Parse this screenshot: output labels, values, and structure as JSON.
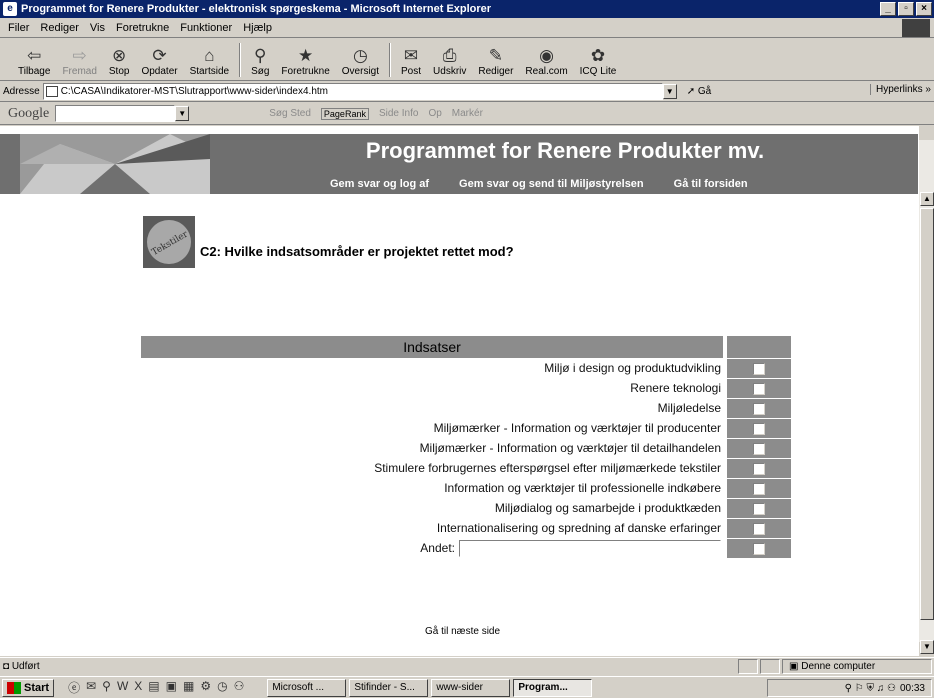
{
  "window": {
    "title": "Programmet for Renere Produkter - elektronisk spørgeskema - Microsoft Internet Explorer"
  },
  "menu": [
    "Filer",
    "Rediger",
    "Vis",
    "Foretrukne",
    "Funktioner",
    "Hjælp"
  ],
  "toolbar": [
    {
      "label": "Tilbage",
      "icon": "back-icon",
      "glyph": "⇦"
    },
    {
      "label": "Fremad",
      "icon": "forward-icon",
      "glyph": "⇨",
      "disabled": true
    },
    {
      "label": "Stop",
      "icon": "stop-icon",
      "glyph": "⊗"
    },
    {
      "label": "Opdater",
      "icon": "refresh-icon",
      "glyph": "⟳"
    },
    {
      "label": "Startside",
      "icon": "home-icon",
      "glyph": "⌂"
    },
    {
      "label": "Søg",
      "icon": "search-icon",
      "glyph": "⚲"
    },
    {
      "label": "Foretrukne",
      "icon": "favorites-icon",
      "glyph": "★"
    },
    {
      "label": "Oversigt",
      "icon": "history-icon",
      "glyph": "◷"
    },
    {
      "label": "Post",
      "icon": "mail-icon",
      "glyph": "✉"
    },
    {
      "label": "Udskriv",
      "icon": "print-icon",
      "glyph": "⎙"
    },
    {
      "label": "Rediger",
      "icon": "edit-icon",
      "glyph": "✎"
    },
    {
      "label": "Real.com",
      "icon": "realcom-icon",
      "glyph": "◉"
    },
    {
      "label": "ICQ Lite",
      "icon": "icq-icon",
      "glyph": "✿"
    }
  ],
  "address": {
    "label": "Adresse",
    "url": "C:\\CASA\\Indikatorer-MST\\Slutrapport\\www-sider\\index4.htm",
    "go": "Gå",
    "links": "Hyperlinks"
  },
  "googlebar": {
    "logo": "Google",
    "items": [
      "Søg Sted",
      "PageRank",
      "Side Info",
      "Op",
      "Markér"
    ]
  },
  "banner": {
    "title": "Programmet for Renere Produkter mv.",
    "nav": [
      "Gem svar og log af",
      "Gem svar og send til Miljøstyrelsen",
      "Gå til forsiden"
    ]
  },
  "question": {
    "icon_text": "Tekstiler",
    "title": "C2: Hvilke indsatsområder er projektet rettet mod?"
  },
  "table": {
    "header": "Indsatser",
    "rows": [
      "Miljø i design og produktudvikling",
      "Renere teknologi",
      "Miljøledelse",
      "Miljømærker - Information og værktøjer til producenter",
      "Miljømærker - Information og værktøjer til detailhandelen",
      "Stimulere forbrugernes efterspørgsel efter miljømærkede tekstiler",
      "Information og værktøjer til professionelle indkøbere",
      "Miljødialog og samarbejde i produktkæden",
      "Internationalisering og spredning af danske erfaringer"
    ],
    "other_label": "Andet:",
    "other_value": ""
  },
  "next_link": "Gå til næste side",
  "status": {
    "text": "Udført",
    "zone": "Denne computer"
  },
  "taskbar": {
    "start": "Start",
    "tasks": [
      "Microsoft ...",
      "Stifinder - S...",
      "www-sider",
      "Program..."
    ],
    "clock": "00:33"
  }
}
